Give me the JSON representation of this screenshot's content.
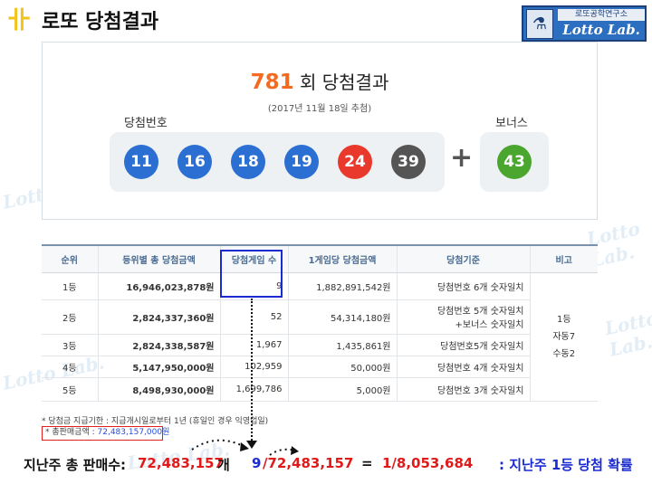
{
  "header": {
    "logo_glyph": "卝",
    "title": "로또 당첨결과",
    "brand_sub": "로또공학연구소",
    "brand_name": "Lotto Lab.",
    "brand_icon": "flask-icon"
  },
  "watermark": {
    "text": "Lotto Lab."
  },
  "result": {
    "draw_number": "781",
    "draw_suffix": " 회 당첨결과",
    "draw_date": "(2017년 11월 18일 추첨)",
    "winning_label": "당첨번호",
    "bonus_label": "보너스",
    "numbers": [
      "11",
      "16",
      "18",
      "19",
      "24",
      "39"
    ],
    "plus": "+",
    "bonus": "43",
    "ball_colors": [
      "#2a6fd1",
      "#2a6fd1",
      "#2a6fd1",
      "#2a6fd1",
      "#e8392c",
      "#555555"
    ],
    "bonus_color": "#4aa62e"
  },
  "table": {
    "headers": [
      "순위",
      "등위별 총 당첨금액",
      "당첨게임 수",
      "1게임당 당첨금액",
      "당첨기준",
      "비고"
    ],
    "rows": [
      {
        "rank": "1등",
        "total": "16,946,023,878원",
        "games": "9",
        "per_game": "1,882,891,542원",
        "criteria": [
          "당첨번호 6개 숫자일치"
        ]
      },
      {
        "rank": "2등",
        "total": "2,824,337,360원",
        "games": "52",
        "per_game": "54,314,180원",
        "criteria": [
          "당첨번호 5개 숫자일치",
          "+보너스 숫자일치"
        ]
      },
      {
        "rank": "3등",
        "total": "2,824,338,587원",
        "games": "1,967",
        "per_game": "1,435,861원",
        "criteria": [
          "당첨번호5개 숫자일치"
        ]
      },
      {
        "rank": "4등",
        "total": "5,147,950,000원",
        "games": "102,959",
        "per_game": "50,000원",
        "criteria": [
          "당첨번호 4개 숫자일치"
        ]
      },
      {
        "rank": "5등",
        "total": "8,498,930,000원",
        "games": "1,699,786",
        "per_game": "5,000원",
        "criteria": [
          "당첨번호 3개 숫자일치"
        ]
      }
    ],
    "note": [
      "1등",
      "자동7",
      "수동2"
    ]
  },
  "notice": "* 당첨금 지급기한 : 지급개시일로부터 1년 (휴일인 경우 익영업일)",
  "sales": {
    "label": "* 총판매금액 : ",
    "value": "72,483,157,000원"
  },
  "bottom": {
    "label": "지난주 총 판매수: ",
    "sales_count": "72,483,157",
    "unit": "개",
    "winners": "9",
    "fraction": "/72,483,157",
    "equals": "=",
    "probability": "1/8,053,684",
    "caption": ": 지난주 1등 당첨 확률"
  }
}
